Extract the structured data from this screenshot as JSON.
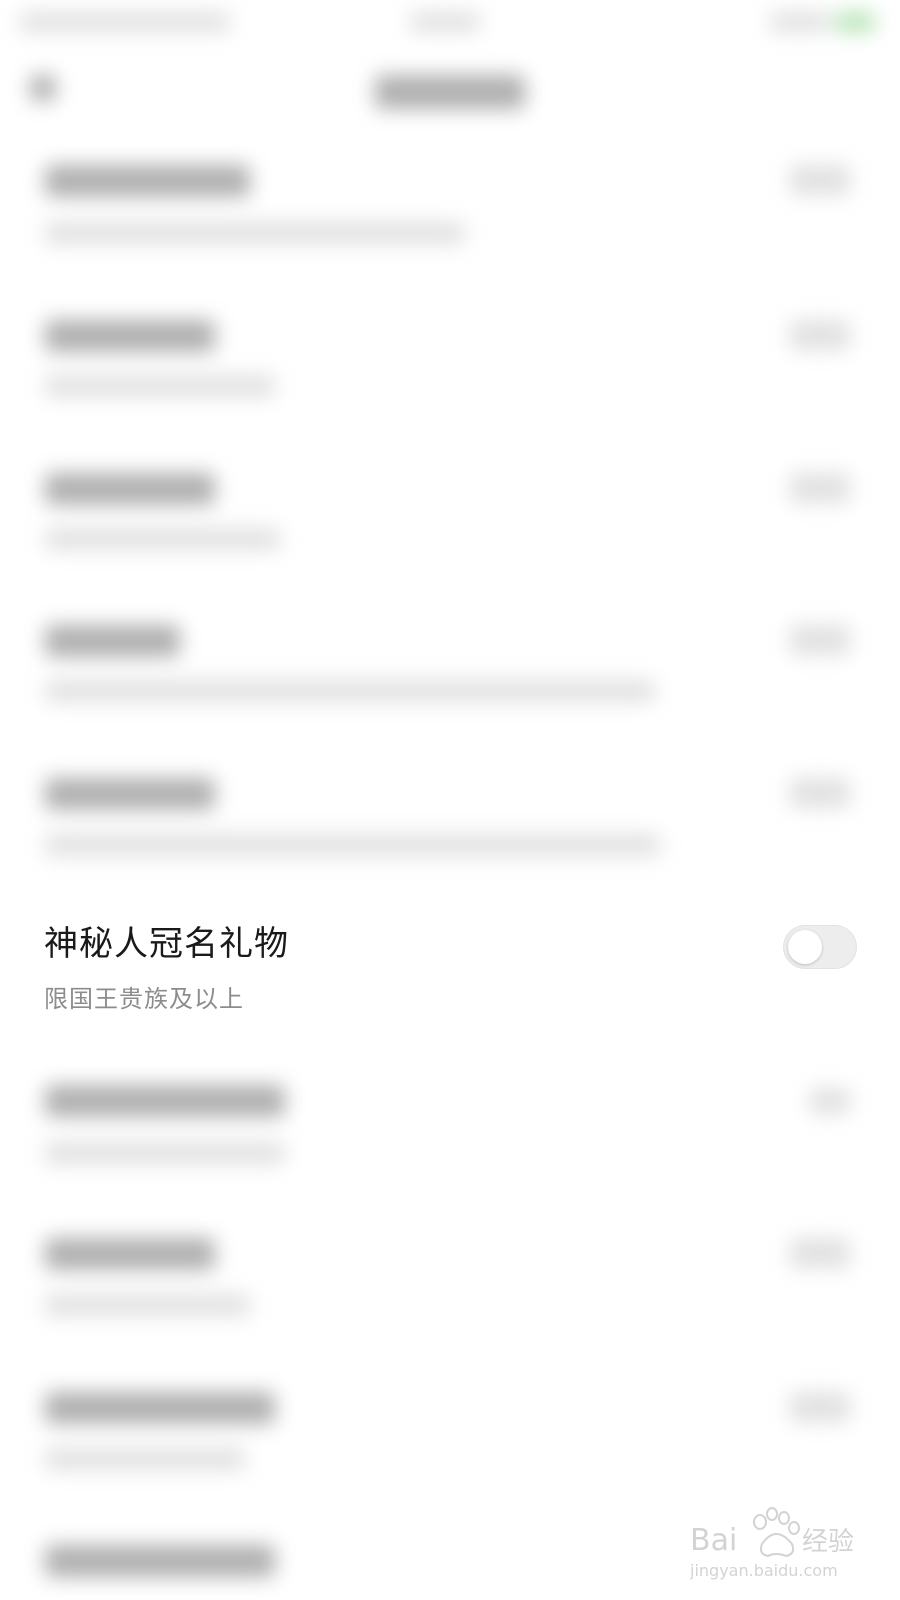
{
  "setting": {
    "title": "神秘人冠名礼物",
    "subtitle": "限国王贵族及以上",
    "enabled": false
  },
  "colors": {
    "background": "#ffffff",
    "title": "#1a1a1a",
    "subtitle": "#8c8c8c",
    "toggle_track": "#ededed",
    "toggle_knob": "#ffffff",
    "status_accent": "#7ccf7c"
  },
  "watermark": {
    "brand": "Baidu经验",
    "url": "jingyan.baidu.com"
  }
}
